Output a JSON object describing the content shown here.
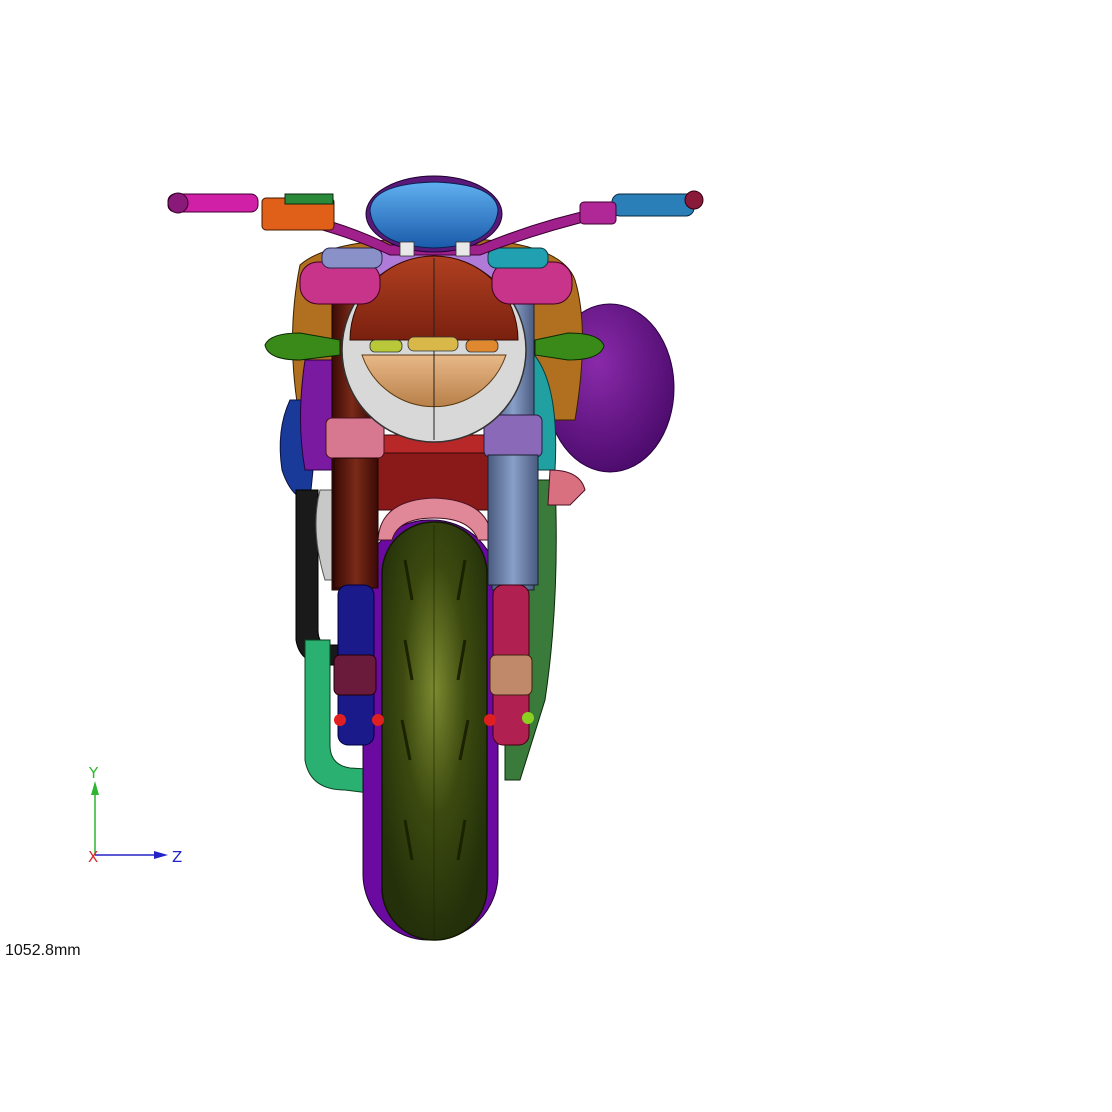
{
  "viewport": {
    "background": "#ffffff",
    "scale_readout": "1052.8mm"
  },
  "triad": {
    "y_label": "Y",
    "z_label": "Z",
    "x_label": "X",
    "y_color": "#2fb52f",
    "z_color": "#2323c8",
    "x_color": "#d42a2a"
  },
  "model": {
    "name": "motorcycle-front-view",
    "colors": {
      "tire": "#3c4a10",
      "tire_highlight": "#6b7a28",
      "handlebar": "#a0208c",
      "grip_left": "#d020a8",
      "grip_right": "#2a7fb8",
      "clutch_box": "#e0601a",
      "gauge": "#2f7fd8",
      "gauge_rim": "#5a1a7a",
      "headlight_upper": "#9c3018",
      "headlight_lower": "#d6a06a",
      "headlight_bezel": "#d8d8d8",
      "headlight_mount": "#b07ad8",
      "fork_left": "#5a1a10",
      "fork_right": "#6a80a8",
      "fork_lower_left": "#1a1a8a",
      "fork_lower_right": "#b02050",
      "fork_collar_left": "#d87890",
      "fork_collar_right": "#8a6ab8",
      "frame_red": "#8a1a1a",
      "tank": "#b07020",
      "side_blue": "#1a3a9a",
      "exhaust": "#1a1a1a",
      "pipe_green": "#2ab070",
      "purple_body": "#6a0a8a",
      "purple_ball": "#5a0a7a",
      "mudguard": "#d07080",
      "indicator": "#3a8a1a",
      "cross_bar": "#c8348a",
      "bolts": "#e02020",
      "bolts_green": "#8ad020",
      "radiator_green": "#3a7a3a",
      "teal": "#20a0a0"
    }
  }
}
